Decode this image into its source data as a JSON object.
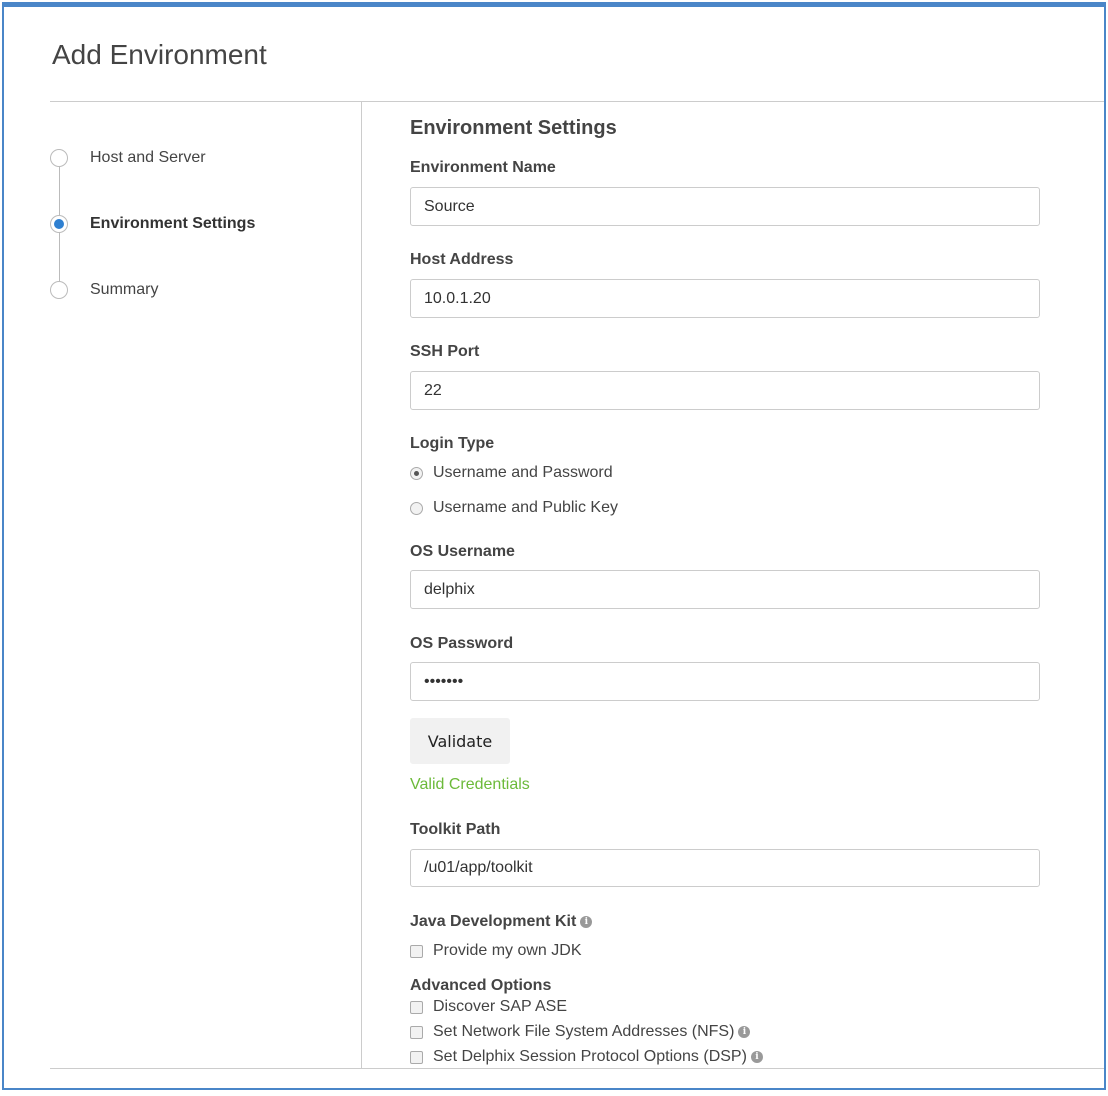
{
  "dialog": {
    "title": "Add Environment"
  },
  "steps": [
    {
      "label": "Host and Server",
      "active": false
    },
    {
      "label": "Environment Settings",
      "active": true
    },
    {
      "label": "Summary",
      "active": false
    }
  ],
  "form": {
    "section_title": "Environment Settings",
    "environment_name": {
      "label": "Environment Name",
      "value": "Source"
    },
    "host_address": {
      "label": "Host Address",
      "value": "10.0.1.20"
    },
    "ssh_port": {
      "label": "SSH Port",
      "value": "22"
    },
    "login_type": {
      "label": "Login Type",
      "options": [
        "Username and Password",
        "Username and Public Key"
      ],
      "selected": "Username and Password"
    },
    "os_username": {
      "label": "OS Username",
      "value": "delphix"
    },
    "os_password": {
      "label": "OS Password",
      "value": "•••••••"
    },
    "validate_label": "Validate",
    "validation_message": "Valid Credentials",
    "toolkit_path": {
      "label": "Toolkit Path",
      "value": "/u01/app/toolkit"
    },
    "jdk": {
      "label": "Java Development Kit",
      "option": "Provide my own JDK",
      "checked": false
    },
    "advanced": {
      "label": "Advanced Options",
      "options": [
        {
          "label": "Discover SAP ASE",
          "checked": false,
          "info": false
        },
        {
          "label": "Set Network File System Addresses (NFS)",
          "checked": false,
          "info": true
        },
        {
          "label": "Set Delphix Session Protocol Options (DSP)",
          "checked": false,
          "info": true
        }
      ]
    }
  },
  "colors": {
    "accent": "#2f80d1",
    "border": "#4a86c8",
    "success": "#6cba3a"
  }
}
